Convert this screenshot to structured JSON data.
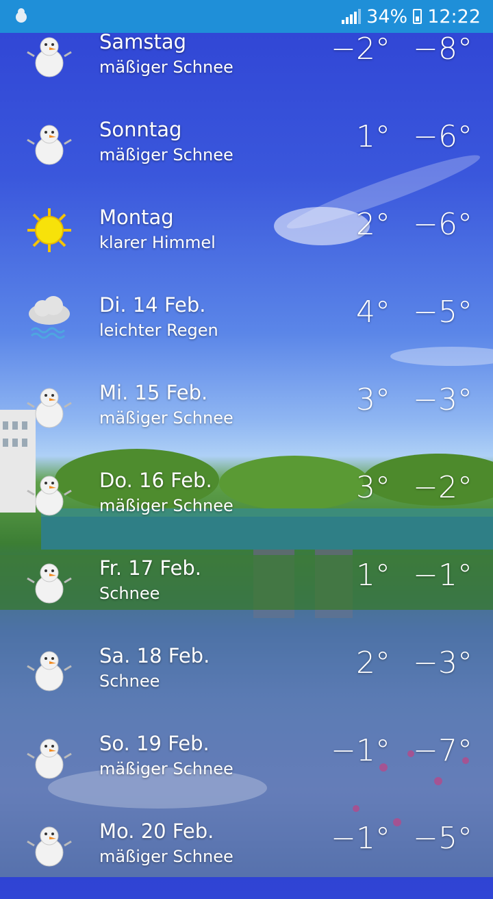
{
  "status_bar": {
    "battery_percent": "34%",
    "time": "12:22"
  },
  "forecast": [
    {
      "day": "Samstag",
      "desc": "mäßiger Schnee",
      "high": "−2°",
      "low": "−8°",
      "icon": "snowman-icon"
    },
    {
      "day": "Sonntag",
      "desc": "mäßiger Schnee",
      "high": "1°",
      "low": "−6°",
      "icon": "snowman-icon"
    },
    {
      "day": "Montag",
      "desc": "klarer Himmel",
      "high": "2°",
      "low": "−6°",
      "icon": "sun-icon"
    },
    {
      "day": "Di. 14 Feb.",
      "desc": "leichter Regen",
      "high": "4°",
      "low": "−5°",
      "icon": "rain-cloud-icon"
    },
    {
      "day": "Mi. 15 Feb.",
      "desc": "mäßiger Schnee",
      "high": "3°",
      "low": "−3°",
      "icon": "snowman-icon"
    },
    {
      "day": "Do. 16 Feb.",
      "desc": "mäßiger Schnee",
      "high": "3°",
      "low": "−2°",
      "icon": "snowman-icon"
    },
    {
      "day": "Fr. 17 Feb.",
      "desc": "Schnee",
      "high": "1°",
      "low": "−1°",
      "icon": "snowman-icon"
    },
    {
      "day": "Sa. 18 Feb.",
      "desc": "Schnee",
      "high": "2°",
      "low": "−3°",
      "icon": "snowman-icon"
    },
    {
      "day": "So. 19 Feb.",
      "desc": "mäßiger Schnee",
      "high": "−1°",
      "low": "−7°",
      "icon": "snowman-icon"
    },
    {
      "day": "Mo. 20 Feb.",
      "desc": "mäßiger Schnee",
      "high": "−1°",
      "low": "−5°",
      "icon": "snowman-icon"
    }
  ]
}
